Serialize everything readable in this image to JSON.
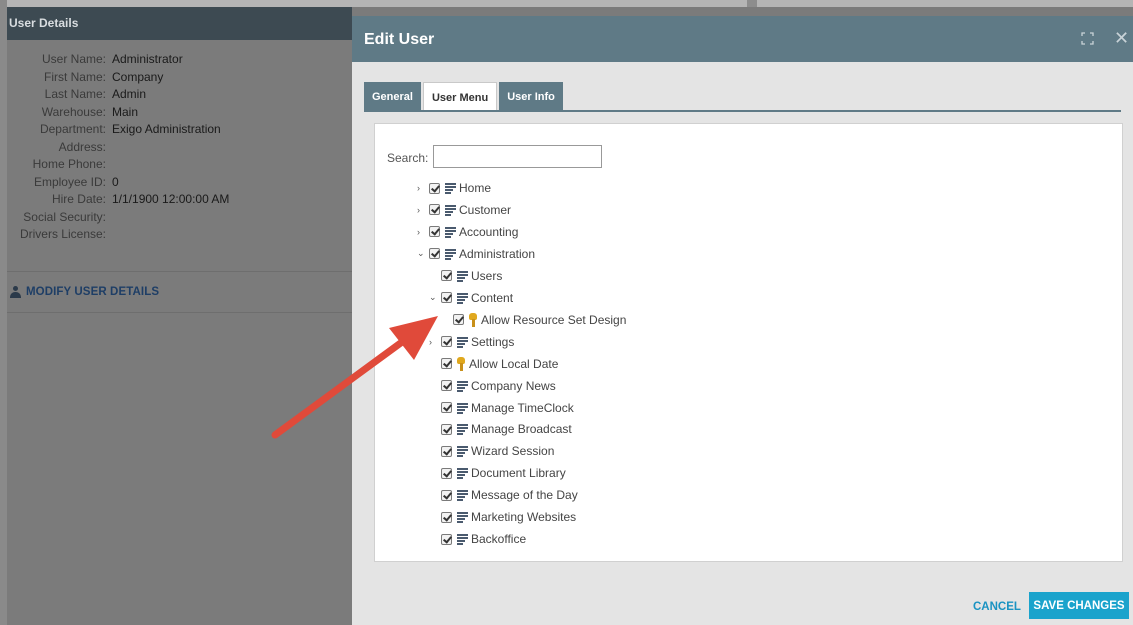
{
  "user_panel": {
    "header": "User Details",
    "details": [
      {
        "label": "User Name:",
        "value": "Administrator"
      },
      {
        "label": "First Name:",
        "value": "Company"
      },
      {
        "label": "Last Name:",
        "value": "Admin"
      },
      {
        "label": "Warehouse:",
        "value": "Main"
      },
      {
        "label": "Department:",
        "value": "Exigo Administration"
      },
      {
        "label": "Address:",
        "value": ""
      },
      {
        "label": "Home Phone:",
        "value": ""
      },
      {
        "label": "Employee ID:",
        "value": "0"
      },
      {
        "label": "Hire Date:",
        "value": "1/1/1900 12:00:00 AM"
      },
      {
        "label": "Social Security:",
        "value": ""
      },
      {
        "label": "Drivers License:",
        "value": ""
      }
    ],
    "modify_link": "MODIFY USER DETAILS"
  },
  "modal": {
    "title": "Edit User",
    "tabs": [
      {
        "label": "General",
        "active": false
      },
      {
        "label": "User Menu",
        "active": true
      },
      {
        "label": "User Info",
        "active": false
      }
    ],
    "search": {
      "label": "Search:",
      "value": "",
      "placeholder": ""
    },
    "tree": [
      {
        "label": "Home",
        "indent": 0,
        "chevron": "›",
        "icon": "list-icon",
        "checked": true
      },
      {
        "label": "Customer",
        "indent": 0,
        "chevron": "›",
        "icon": "list-icon",
        "checked": true
      },
      {
        "label": "Accounting",
        "indent": 0,
        "chevron": "›",
        "icon": "list-icon",
        "checked": true
      },
      {
        "label": "Administration",
        "indent": 0,
        "chevron": "⌄",
        "icon": "list-icon",
        "checked": true
      },
      {
        "label": "Users",
        "indent": 1,
        "chevron": "",
        "icon": "list-icon",
        "checked": true
      },
      {
        "label": "Content",
        "indent": 1,
        "chevron": "⌄",
        "icon": "list-icon",
        "checked": true
      },
      {
        "label": "Allow Resource Set Design",
        "indent": 2,
        "chevron": "",
        "icon": "key-icon",
        "checked": true
      },
      {
        "label": "Settings",
        "indent": 1,
        "chevron": "›",
        "icon": "list-icon",
        "checked": true
      },
      {
        "label": "Allow Local Date",
        "indent": 1,
        "chevron": "",
        "icon": "key-icon",
        "checked": true
      },
      {
        "label": "Company News",
        "indent": 1,
        "chevron": "",
        "icon": "list-icon",
        "checked": true
      },
      {
        "label": "Manage TimeClock",
        "indent": 1,
        "chevron": "",
        "icon": "list-icon",
        "checked": true
      },
      {
        "label": "Manage Broadcast",
        "indent": 1,
        "chevron": "",
        "icon": "list-icon",
        "checked": true
      },
      {
        "label": "Wizard Session",
        "indent": 1,
        "chevron": "",
        "icon": "list-icon",
        "checked": true
      },
      {
        "label": "Document Library",
        "indent": 1,
        "chevron": "",
        "icon": "list-icon",
        "checked": true
      },
      {
        "label": "Message of the Day",
        "indent": 1,
        "chevron": "",
        "icon": "list-icon",
        "checked": true
      },
      {
        "label": "Marketing Websites",
        "indent": 1,
        "chevron": "",
        "icon": "list-icon",
        "checked": true
      },
      {
        "label": "Backoffice",
        "indent": 1,
        "chevron": "",
        "icon": "list-icon",
        "checked": true
      }
    ],
    "cancel_label": "CANCEL",
    "save_label": "SAVE CHANGES"
  },
  "colors": {
    "header_bg": "#5f7a86",
    "primary_button": "#1aa3cc",
    "link_blue": "#1a93c2",
    "annotation_arrow": "#e04a3a"
  }
}
